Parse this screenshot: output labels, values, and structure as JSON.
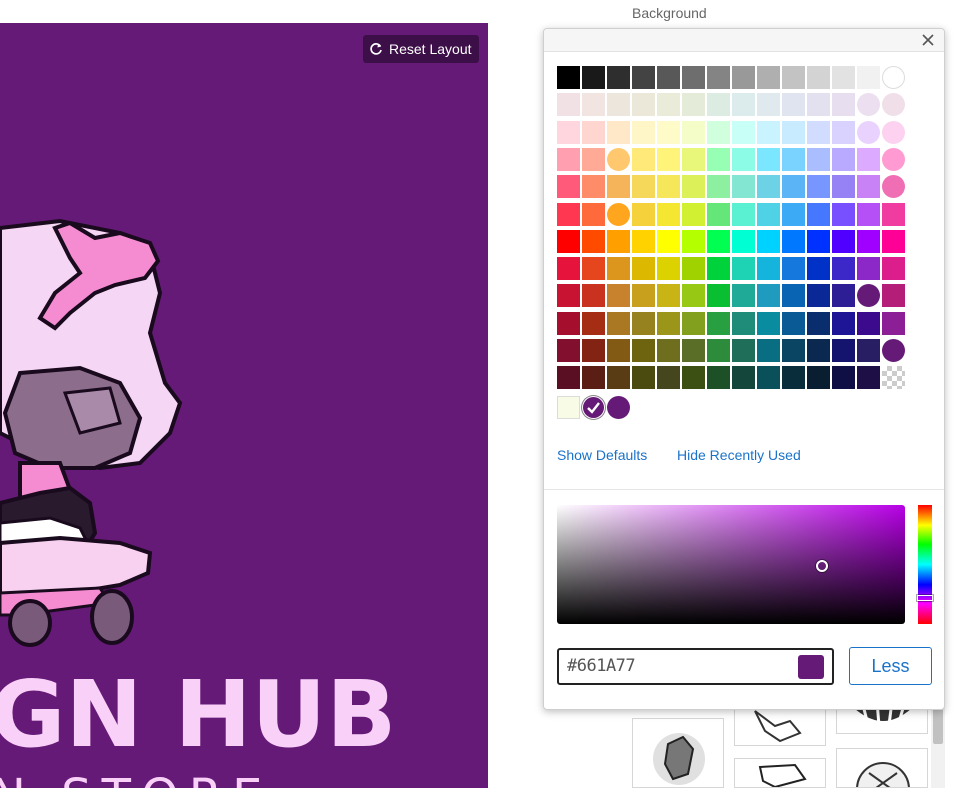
{
  "canvas": {
    "background_color": "#661A77",
    "reset_layout_label": "Reset Layout",
    "design_text_line1": "GN HUB",
    "design_text_line2": "N STORE"
  },
  "sidebar": {
    "section_label": "Background"
  },
  "color_picker": {
    "palette_rows": [
      [
        "#000000",
        "#191919",
        "#2e2e2e",
        "#434343",
        "#585858",
        "#6e6e6e",
        "#848484",
        "#999999",
        "#afafaf",
        "#c3c3c3",
        "#d3d3d3",
        "#e2e2e2",
        "#f1f1f1",
        "#ffffff"
      ],
      [
        "#f1e0e4",
        "#f1e4e1",
        "#ede6dc",
        "#ebe8d9",
        "#ebebd9",
        "#e4ecd9",
        "#dcece3",
        "#dcecec",
        "#dfe9ee",
        "#e0e4f0",
        "#e3e1f0",
        "#e7dff0",
        "#ecdff0",
        "#f0dfe9"
      ],
      [
        "#ffd6dd",
        "#ffd6cf",
        "#ffe8c8",
        "#fff6c8",
        "#fffbc8",
        "#f4fcc8",
        "#cfffdc",
        "#c8fff6",
        "#c8f3ff",
        "#c8ebff",
        "#d2dcff",
        "#d9d2ff",
        "#ead2ff",
        "#fcd2f0"
      ],
      [
        "#ff9faf",
        "#ffaa96",
        "#ffc86e",
        "#ffe978",
        "#fff47a",
        "#e8f77a",
        "#96ffb4",
        "#8cfce6",
        "#7ae6ff",
        "#7ad2ff",
        "#aabeff",
        "#b9aaff",
        "#dcaaff",
        "#ff9ad2"
      ],
      [
        "#ff5a7a",
        "#ff8c69",
        "#f5b45a",
        "#f5d75a",
        "#f5e65a",
        "#dcf05a",
        "#8cf0a0",
        "#82e6d2",
        "#6ed2e6",
        "#5ab4f5",
        "#7896ff",
        "#9682f5",
        "#c882f5",
        "#f06eb4"
      ],
      [
        "#ff3750",
        "#ff6a3c",
        "#ffa51e",
        "#f5d23c",
        "#f5e632",
        "#d2f032",
        "#64e678",
        "#5af0d2",
        "#50d2e6",
        "#3caaf5",
        "#4678ff",
        "#7850ff",
        "#b450f5",
        "#f03ca0"
      ],
      [
        "#ff0000",
        "#ff4b00",
        "#ffa000",
        "#ffd200",
        "#ffff00",
        "#b4ff00",
        "#00ff50",
        "#00ffd2",
        "#00d2ff",
        "#0078ff",
        "#0032ff",
        "#5000ff",
        "#a000ff",
        "#ff0096"
      ],
      [
        "#e6143c",
        "#e6461e",
        "#dc961e",
        "#dcb900",
        "#dcd200",
        "#a0d200",
        "#00d23c",
        "#1ed2b4",
        "#14b4dc",
        "#1478dc",
        "#0032c8",
        "#3c28c8",
        "#8c28c8",
        "#dc1e8c"
      ],
      [
        "#c81432",
        "#c8321e",
        "#c8822d",
        "#c8a01e",
        "#c8b414",
        "#96c814",
        "#0abe32",
        "#1eaa96",
        "#1e9bbe",
        "#0a64b4",
        "#0a2896",
        "#2d1e96",
        "#661a77",
        "#b41e78"
      ],
      [
        "#a50f2d",
        "#a52d14",
        "#aa7823",
        "#96821e",
        "#9b9619",
        "#82a01e",
        "#28a041",
        "#1e8c78",
        "#0a8ca0",
        "#0a5a96",
        "#0a2d6e",
        "#1e1496",
        "#3c0a8c",
        "#8c1e96"
      ],
      [
        "#820f2d",
        "#822314",
        "#825a14",
        "#6e640f",
        "#6e6e1e",
        "#5a6e28",
        "#2d8c3c",
        "#1e6e5a",
        "#0a6e82",
        "#0a4664",
        "#0a2850",
        "#14146e",
        "#281e64",
        "#661a77"
      ],
      [
        "#5a0f23",
        "#5a1e14",
        "#5a3c14",
        "#4b4b0f",
        "#46461e",
        "#3c5014",
        "#1e5028",
        "#14463c",
        "#0a505a",
        "#0a2d3c",
        "#0a1e32",
        "#0f0f46",
        "#1e0f46",
        "#transparent"
      ]
    ],
    "circled_cells": [
      [
        0,
        13
      ],
      [
        1,
        12
      ],
      [
        1,
        13
      ],
      [
        2,
        12
      ],
      [
        2,
        13
      ],
      [
        3,
        2
      ],
      [
        3,
        13
      ],
      [
        3,
        14
      ],
      [
        4,
        13
      ],
      [
        4,
        14
      ],
      [
        5,
        2
      ],
      [
        8,
        12
      ],
      [
        10,
        13
      ]
    ],
    "recent_colors": [
      "#f8fbe6",
      "#661A77",
      "#661A77"
    ],
    "show_defaults_label": "Show Defaults",
    "hide_recent_label": "Hide Recently Used",
    "hex_value": "#661A77",
    "current_color": "#661A77",
    "less_label": "Less"
  }
}
